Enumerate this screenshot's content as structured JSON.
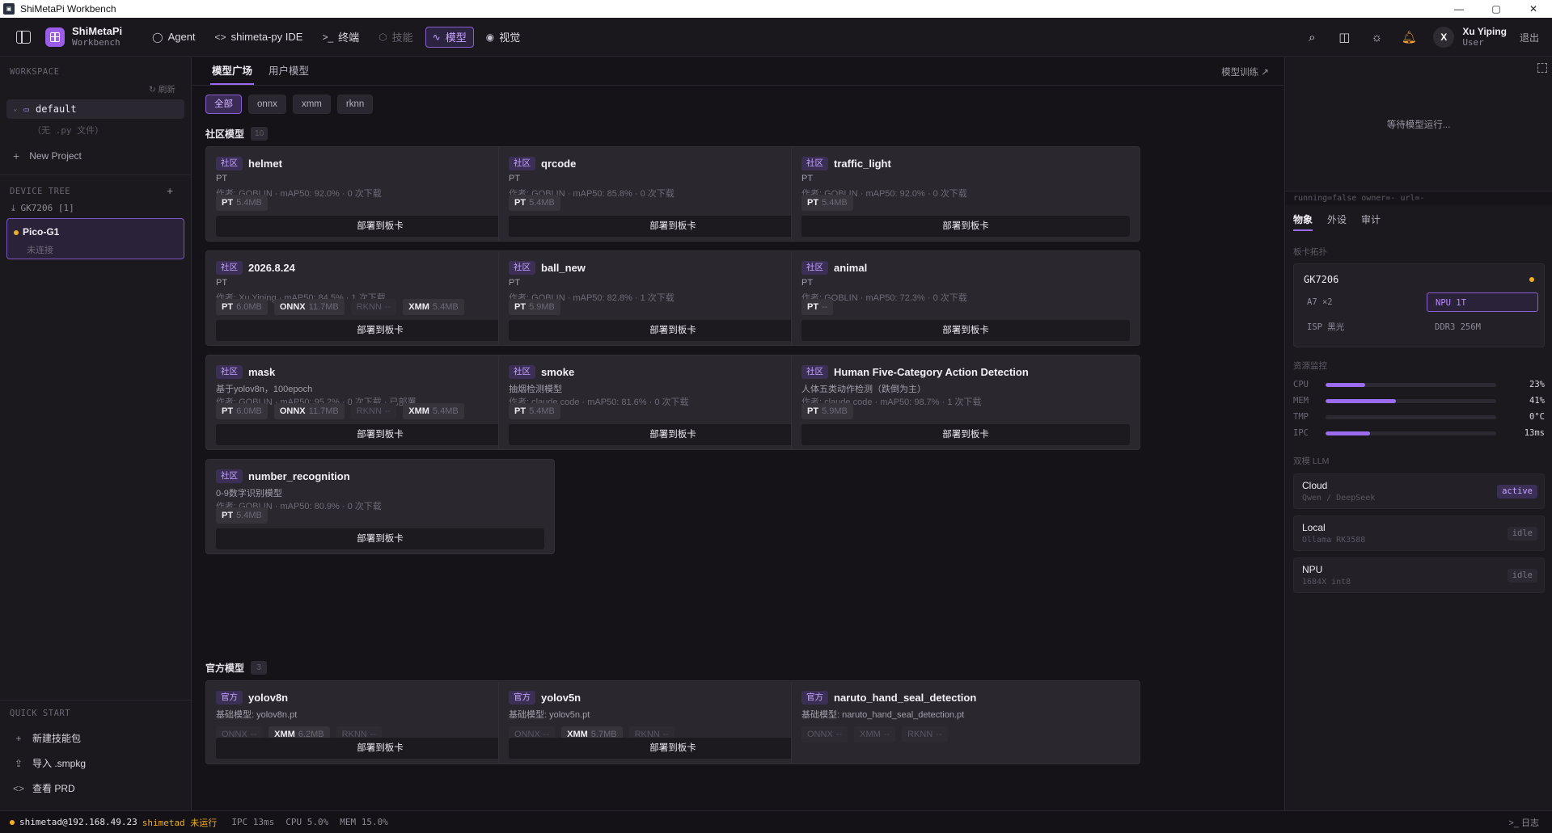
{
  "window": {
    "title": "ShiMetaPi Workbench",
    "buttons": [
      "—",
      "▢",
      "✕"
    ]
  },
  "brand": {
    "name": "ShiMetaPi",
    "sub": "Workbench"
  },
  "nav": [
    {
      "label": "Agent",
      "icon": "chat-icon",
      "state": "normal"
    },
    {
      "label": "shimeta-py IDE",
      "icon": "code-icon",
      "state": "normal"
    },
    {
      "label": "终端",
      "icon": "terminal-icon",
      "state": "normal"
    },
    {
      "label": "技能",
      "icon": "package-icon",
      "state": "disabled"
    },
    {
      "label": "模型",
      "icon": "activity-icon",
      "state": "active"
    },
    {
      "label": "视觉",
      "icon": "eye-icon",
      "state": "normal"
    }
  ],
  "user": {
    "initial": "X",
    "name": "Xu Yiping",
    "role": "User",
    "logout": "退出"
  },
  "sidebar": {
    "workspace_label": "WORKSPACE",
    "refresh": "刷新",
    "workspace": "default",
    "empty": "（无 .py 文件）",
    "new_project": "New Project",
    "device_tree_label": "DEVICE TREE",
    "gk_item": "GK7206 [1]",
    "device": {
      "name": "Pico-G1",
      "status": "未连接"
    },
    "quick_start_label": "QUICK START",
    "quick": [
      "新建技能包",
      "导入 .smpkg",
      "查看 PRD"
    ]
  },
  "main": {
    "tabs": [
      "模型广场",
      "用户模型"
    ],
    "train_link": "模型训练",
    "filters": [
      "全部",
      "onnx",
      "xmm",
      "rknn"
    ],
    "community_title": "社区模型",
    "community_count": "10",
    "official_title": "官方模型",
    "official_count": "3",
    "deploy": "部署到板卡",
    "community_badge": "社区",
    "official_badge": "官方",
    "community": [
      {
        "name": "helmet",
        "desc": "PT",
        "meta": "作者: GOBLIN · mAP50: 92.0% · 0 次下载",
        "fmts": [
          {
            "k": "PT",
            "v": "5.4MB",
            "on": true
          }
        ]
      },
      {
        "name": "qrcode",
        "desc": "PT",
        "meta": "作者: GOBLIN · mAP50: 85.8% · 0 次下载",
        "fmts": [
          {
            "k": "PT",
            "v": "5.4MB",
            "on": true
          }
        ]
      },
      {
        "name": "traffic_light",
        "desc": "PT",
        "meta": "作者: GOBLIN · mAP50: 92.0% · 0 次下载",
        "fmts": [
          {
            "k": "PT",
            "v": "5.4MB",
            "on": true
          }
        ]
      },
      {
        "name": "2026.8.24",
        "desc": "PT",
        "meta": "作者: Xu Yiping · mAP50: 84.5% · 1 次下载",
        "fmts": [
          {
            "k": "PT",
            "v": "6.0MB",
            "on": true
          },
          {
            "k": "ONNX",
            "v": "11.7MB",
            "on": true
          },
          {
            "k": "RKNN",
            "v": "--",
            "on": false
          },
          {
            "k": "XMM",
            "v": "5.4MB",
            "on": true
          }
        ]
      },
      {
        "name": "ball_new",
        "desc": "PT",
        "meta": "作者: GOBLIN · mAP50: 82.8% · 1 次下载",
        "fmts": [
          {
            "k": "PT",
            "v": "5.9MB",
            "on": true
          }
        ]
      },
      {
        "name": "animal",
        "desc": "PT",
        "meta": "作者: GOBLIN · mAP50: 72.3% · 0 次下载",
        "fmts": [
          {
            "k": "PT",
            "v": "--",
            "on": true
          }
        ]
      },
      {
        "name": "mask",
        "desc": "基于yolov8n，100epoch",
        "meta": "作者: GOBLIN · mAP50: 95.2% · 0 次下载 · 已部署",
        "fmts": [
          {
            "k": "PT",
            "v": "6.0MB",
            "on": true
          },
          {
            "k": "ONNX",
            "v": "11.7MB",
            "on": true
          },
          {
            "k": "RKNN",
            "v": "--",
            "on": false
          },
          {
            "k": "XMM",
            "v": "5.4MB",
            "on": true
          }
        ]
      },
      {
        "name": "smoke",
        "desc": "抽烟检测模型",
        "meta": "作者: claude code · mAP50: 81.6% · 0 次下载",
        "fmts": [
          {
            "k": "PT",
            "v": "5.4MB",
            "on": true
          }
        ]
      },
      {
        "name": "Human Five-Category Action Detection",
        "desc": "人体五类动作检测（跌倒为主）",
        "meta": "作者: claude code · mAP50: 98.7% · 1 次下载",
        "fmts": [
          {
            "k": "PT",
            "v": "5.9MB",
            "on": true
          }
        ]
      },
      {
        "name": "number_recognition",
        "desc": "0-9数字识别模型",
        "meta": "作者: GOBLIN · mAP50: 80.9% · 0 次下载",
        "fmts": [
          {
            "k": "PT",
            "v": "5.4MB",
            "on": true
          }
        ]
      }
    ],
    "official": [
      {
        "name": "yolov8n",
        "desc": "基础模型: yolov8n.pt",
        "fmts": [
          {
            "k": "ONNX",
            "v": "--",
            "on": false
          },
          {
            "k": "XMM",
            "v": "6.2MB",
            "on": true
          },
          {
            "k": "RKNN",
            "v": "--",
            "on": false
          }
        ],
        "deploy": true
      },
      {
        "name": "yolov5n",
        "desc": "基础模型: yolov5n.pt",
        "fmts": [
          {
            "k": "ONNX",
            "v": "--",
            "on": false
          },
          {
            "k": "XMM",
            "v": "5.7MB",
            "on": true
          },
          {
            "k": "RKNN",
            "v": "--",
            "on": false
          }
        ],
        "deploy": true
      },
      {
        "name": "naruto_hand_seal_detection",
        "desc": "基础模型: naruto_hand_seal_detection.pt",
        "fmts": [
          {
            "k": "ONNX",
            "v": "--",
            "on": false
          },
          {
            "k": "XMM",
            "v": "--",
            "on": false
          },
          {
            "k": "RKNN",
            "v": "--",
            "on": false
          }
        ],
        "deploy": false
      }
    ]
  },
  "right": {
    "waiting": "等待模型运行...",
    "status_line": "running=false owner=- url=-",
    "tabs": [
      "物象",
      "外设",
      "审计"
    ],
    "board_label": "板卡拓扑",
    "board": {
      "name": "GK7206",
      "cells": [
        "A7 ×2",
        "NPU 1T",
        "ISP 黑光",
        "DDR3 256M"
      ]
    },
    "resource_label": "资源监控",
    "meters": [
      {
        "k": "CPU",
        "pct": 23,
        "v": "23%"
      },
      {
        "k": "MEM",
        "pct": 41,
        "v": "41%"
      },
      {
        "k": "TMP",
        "pct": 0,
        "v": "0°C"
      },
      {
        "k": "IPC",
        "pct": 26,
        "v": "13ms"
      }
    ],
    "llm_label": "双模 LLM",
    "llm": [
      {
        "name": "Cloud",
        "sub": "Qwen / DeepSeek",
        "state": "active"
      },
      {
        "name": "Local",
        "sub": "Ollama RK3588",
        "state": "idle"
      },
      {
        "name": "NPU",
        "sub": "1684X int8",
        "state": "idle"
      }
    ]
  },
  "statusbar": {
    "host": "shimetad@192.168.49.23",
    "service": "shimetad 未运行",
    "ipc": "IPC 13ms",
    "cpu": "CPU 5.0%",
    "mem": "MEM 15.0%",
    "log": "日志"
  },
  "colors": {
    "accent": "#9b6cf0",
    "warn": "#f0b020",
    "bg": "#151317"
  }
}
